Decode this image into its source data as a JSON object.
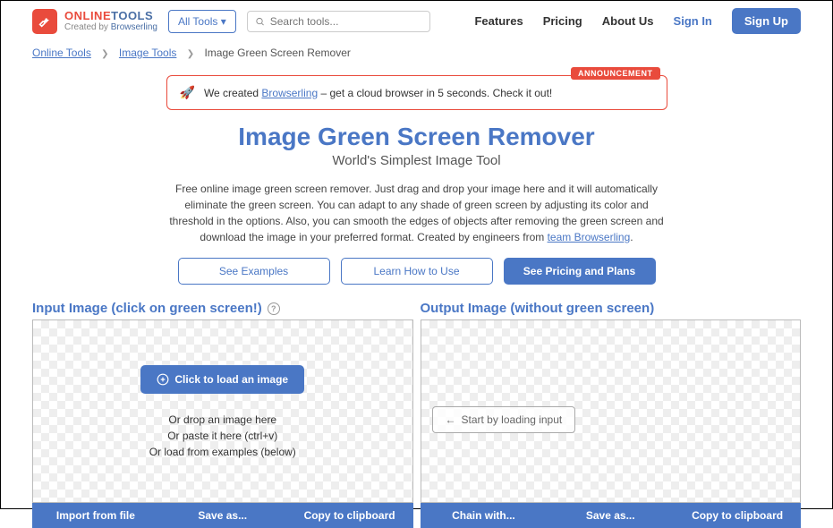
{
  "header": {
    "logo_online": "ONLINE",
    "logo_tools": "TOOLS",
    "logo_sub_prefix": "Created by ",
    "logo_sub_link": "Browserling",
    "alltools": "All Tools",
    "search_placeholder": "Search tools...",
    "nav": {
      "features": "Features",
      "pricing": "Pricing",
      "about": "About Us"
    },
    "signin": "Sign In",
    "signup": "Sign Up"
  },
  "breadcrumb": {
    "a": "Online Tools",
    "b": "Image Tools",
    "c": "Image Green Screen Remover"
  },
  "announcement": {
    "badge": "ANNOUNCEMENT",
    "prefix": "We created ",
    "link": "Browserling",
    "suffix": " – get a cloud browser in 5 seconds. Check it out!"
  },
  "title": "Image Green Screen Remover",
  "subtitle": "World's Simplest Image Tool",
  "description": {
    "body": "Free online image green screen remover. Just drag and drop your image here and it will automatically eliminate the green screen. You can adapt to any shade of green screen by adjusting its color and threshold in the options. Also, you can smooth the edges of objects after removing the green screen and download the image in your preferred format. Created by engineers from ",
    "link": "team Browserling",
    "period": "."
  },
  "buttons": {
    "examples": "See Examples",
    "learn": "Learn How to Use",
    "pricing": "See Pricing and Plans"
  },
  "input_panel": {
    "title": "Input Image (click on green screen!)",
    "load": "Click to load an image",
    "hint1": "Or drop an image here",
    "hint2": "Or paste it here (ctrl+v)",
    "hint3": "Or load from examples (below)",
    "footer": {
      "import": "Import from file",
      "save": "Save as...",
      "copy": "Copy to clipboard"
    }
  },
  "output_panel": {
    "title": "Output Image (without green screen)",
    "start": "Start by loading input",
    "footer": {
      "chain": "Chain with...",
      "save": "Save as...",
      "copy": "Copy to clipboard"
    }
  }
}
